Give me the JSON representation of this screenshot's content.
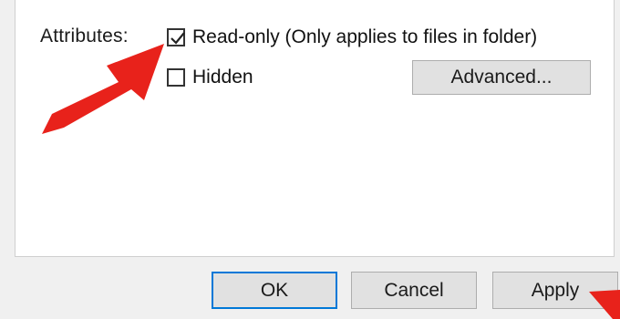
{
  "attributes": {
    "label": "Attributes:",
    "read_only": {
      "label": "Read-only (Only applies to files in folder)",
      "checked": true
    },
    "hidden": {
      "label": "Hidden",
      "checked": false
    },
    "advanced_button": "Advanced..."
  },
  "footer": {
    "ok": "OK",
    "cancel": "Cancel",
    "apply": "Apply"
  },
  "annotations": {
    "arrow_color": "#e8221b"
  }
}
